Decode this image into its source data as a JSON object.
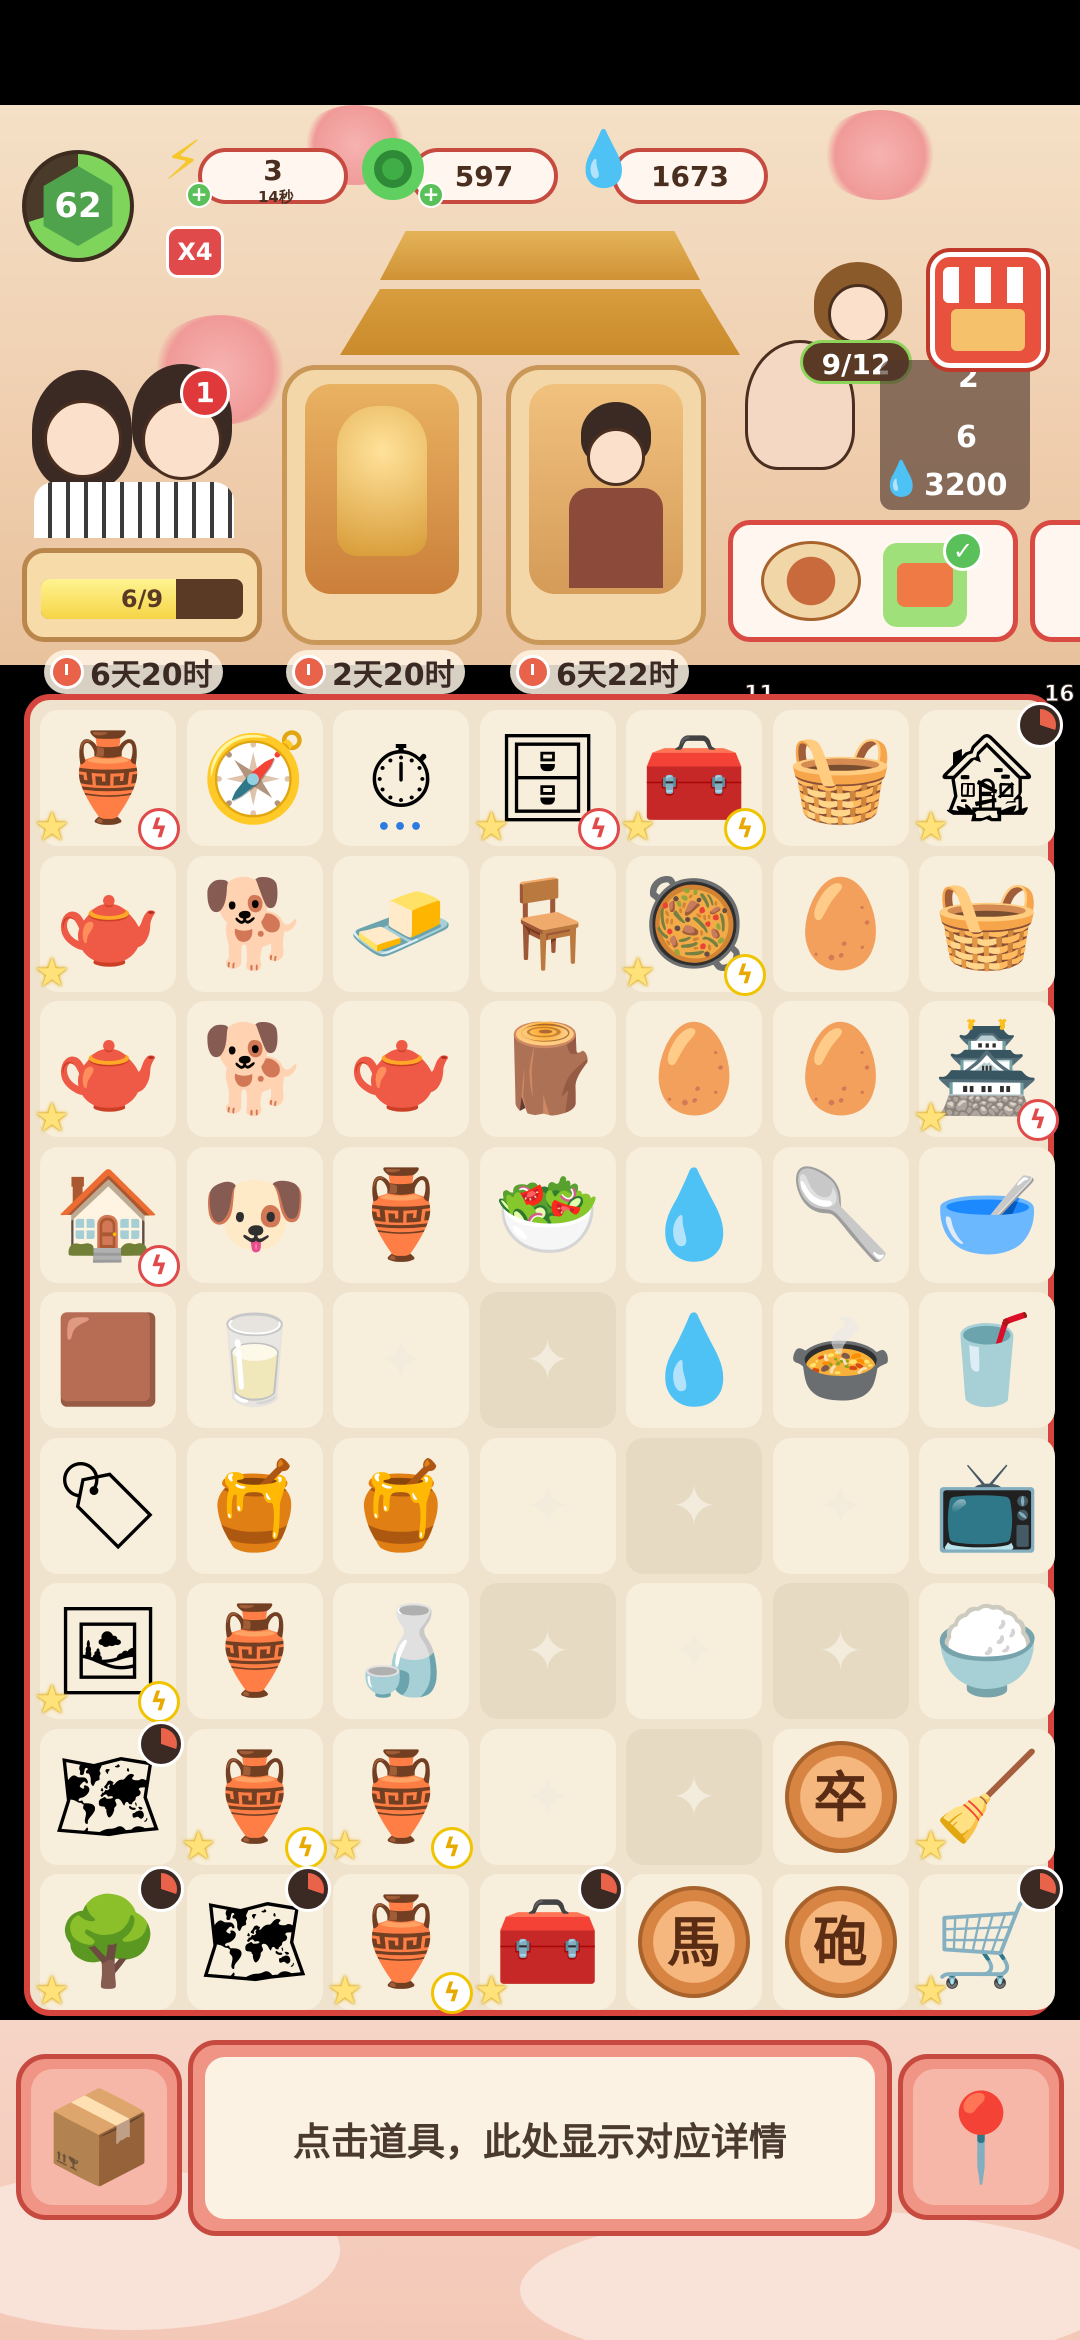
{
  "hud": {
    "level": "62",
    "energy": {
      "value": "3",
      "timer": "14秒",
      "icon": "lightning-icon"
    },
    "coins": {
      "value": "597",
      "icon": "jade-coin-icon"
    },
    "gems": {
      "value": "1673",
      "icon": "blue-flame-icon"
    },
    "multiplier": "X4"
  },
  "characters": {
    "couple_badge": "1",
    "couple_progress_label": "6/9",
    "couple_progress_fraction": 0.6667,
    "timers": [
      "6天20时",
      "2天20时",
      "6天22时"
    ]
  },
  "orders": {
    "order_progress": "9/12",
    "val_a": "2",
    "val_b": "6",
    "reward": "3200",
    "count_a": "11",
    "count_b": "16"
  },
  "board": {
    "rows": [
      [
        {
          "icon": "🏺",
          "name": "antique-clock-cabinet",
          "star": true,
          "bolt": "red"
        },
        {
          "icon": "🧭",
          "name": "octagon-compass"
        },
        {
          "icon": "⏱",
          "name": "gold-pocket-watch",
          "dots": true
        },
        {
          "icon": "🗄",
          "name": "display-cabinet",
          "star": true,
          "bolt": "red"
        },
        {
          "icon": "🧰",
          "name": "sewing-chest",
          "star": true,
          "bolt": "gold"
        },
        {
          "icon": "🧺",
          "name": "red-gift-basket"
        },
        {
          "icon": "🏚",
          "name": "farm-cottage",
          "star": true,
          "cooldown": true
        }
      ],
      [
        {
          "icon": "🫖",
          "name": "enamel-teapot",
          "star": true
        },
        {
          "icon": "🐕",
          "name": "white-puppy"
        },
        {
          "icon": "🧈",
          "name": "gold-ingot"
        },
        {
          "icon": "🪑",
          "name": "wooden-stool"
        },
        {
          "icon": "🥘",
          "name": "bowl-basket",
          "star": true,
          "bolt": "gold"
        },
        {
          "icon": "🥚",
          "name": "egg-tray-large"
        },
        {
          "icon": "🧺",
          "name": "picnic-basket"
        }
      ],
      [
        {
          "icon": "🫖",
          "name": "enamel-teapot-2",
          "star": true
        },
        {
          "icon": "🐕",
          "name": "shiba-dog"
        },
        {
          "icon": "🫖",
          "name": "porcelain-teapot"
        },
        {
          "icon": "🪵",
          "name": "round-stool"
        },
        {
          "icon": "🥚",
          "name": "egg-tray-small"
        },
        {
          "icon": "🥚",
          "name": "egg-tray-medium"
        },
        {
          "icon": "🏯",
          "name": "shop-building",
          "star": true,
          "bolt": "red"
        }
      ],
      [
        {
          "icon": "🏠",
          "name": "dog-house",
          "bolt": "red"
        },
        {
          "icon": "🐶",
          "name": "corgi-dog"
        },
        {
          "icon": "🏺",
          "name": "small-vase"
        },
        {
          "icon": "🥗",
          "name": "vegetable-plate"
        },
        {
          "icon": "💧",
          "name": "blue-flames-cluster"
        },
        {
          "icon": "🥄",
          "name": "garden-trowel"
        },
        {
          "icon": "🥣",
          "name": "sieve-bowl"
        }
      ],
      [
        {
          "icon": "🟫",
          "name": "bean-paste-block"
        },
        {
          "icon": "🥛",
          "name": "white-jar"
        },
        {
          "empty": true,
          "lit": true
        },
        {
          "empty": true
        },
        {
          "icon": "💧",
          "name": "blue-flame"
        },
        {
          "icon": "🍲",
          "name": "mushroom-platter"
        },
        {
          "icon": "🥤",
          "name": "blender"
        }
      ],
      [
        {
          "icon": "🏷",
          "name": "bean-tag-charm"
        },
        {
          "icon": "🍯",
          "name": "sealed-jar-red"
        },
        {
          "icon": "🍯",
          "name": "covered-porcelain-jar"
        },
        {
          "empty": true,
          "lit": true
        },
        {
          "empty": true
        },
        {
          "empty": true,
          "lit": true
        },
        {
          "icon": "📺",
          "name": "microwave-oven"
        }
      ],
      [
        {
          "icon": "🖼",
          "name": "wine-display-rack",
          "star": true,
          "bolt": "gold"
        },
        {
          "icon": "🏺",
          "name": "blue-white-wine-vase"
        },
        {
          "icon": "🍶",
          "name": "wine-jar-red-cloth"
        },
        {
          "empty": true
        },
        {
          "empty": true,
          "lit": true
        },
        {
          "empty": true
        },
        {
          "icon": "🍚",
          "name": "rice-cooker"
        }
      ],
      [
        {
          "icon": "🗺",
          "name": "scroll-blueprint",
          "cooldown": true
        },
        {
          "icon": "🏺",
          "name": "cloisonne-wine-urn",
          "star": true,
          "bolt": "gold"
        },
        {
          "icon": "🏺",
          "name": "cloisonne-wine-urn-2",
          "star": true,
          "bolt": "gold"
        },
        {
          "empty": true,
          "lit": true
        },
        {
          "empty": true
        },
        {
          "chess": "卒",
          "name": "chess-piece-pawn"
        },
        {
          "icon": "🧹",
          "name": "vacuum-cleaner",
          "star": true
        }
      ],
      [
        {
          "icon": "🌳",
          "name": "fruit-tree",
          "star": true,
          "cooldown": true
        },
        {
          "icon": "🗺",
          "name": "scroll-blueprint-2",
          "cooldown": true
        },
        {
          "icon": "🏺",
          "name": "cloisonne-wine-urn-3",
          "star": true,
          "bolt": "gold"
        },
        {
          "icon": "🧰",
          "name": "treasure-chest",
          "star": true,
          "cooldown": true
        },
        {
          "chess": "馬",
          "name": "chess-piece-horse"
        },
        {
          "chess": "砲",
          "name": "chess-piece-cannon"
        },
        {
          "icon": "🛒",
          "name": "luggage-cart",
          "star": true,
          "cooldown": true
        }
      ]
    ]
  },
  "bottom": {
    "info_text": "点击道具，此处显示对应详情",
    "box_icon": "cardboard-box-icon",
    "map_icon": "map-pin-icon"
  }
}
